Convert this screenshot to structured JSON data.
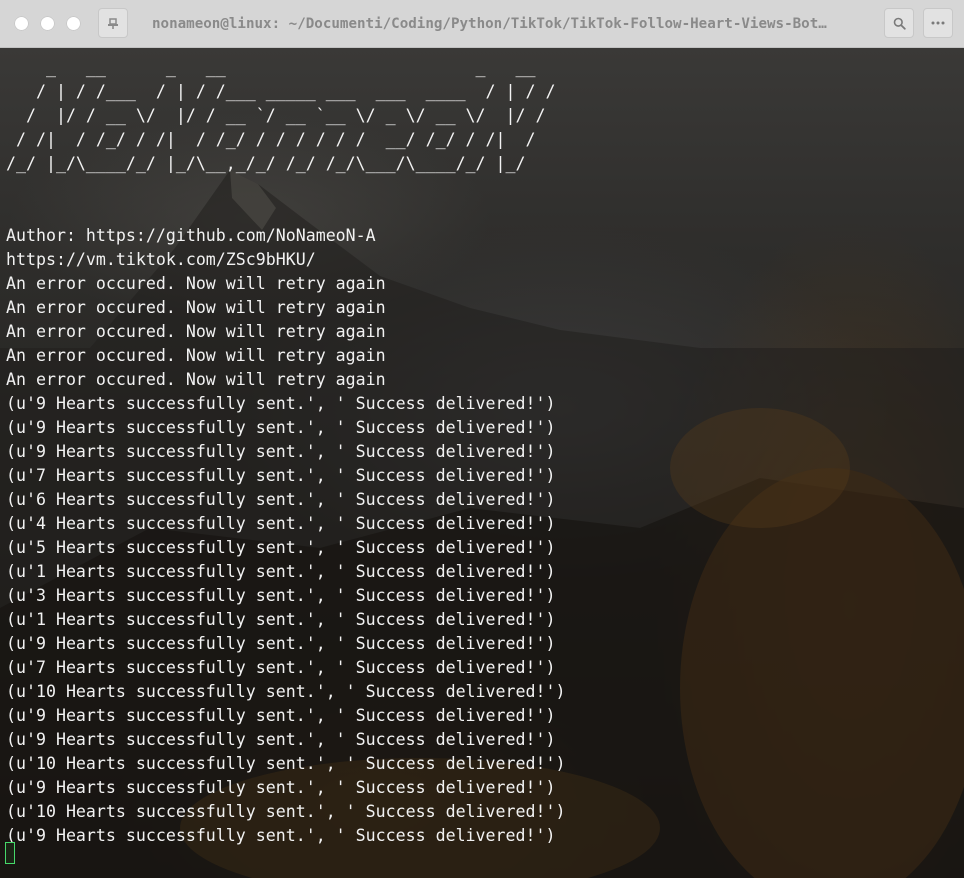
{
  "window": {
    "title": "nonameon@linux: ~/Documenti/Coding/Python/TikTok/TikTok-Follow-Heart-Views-Bot…",
    "buttons": {
      "close": "close-icon",
      "minimize": "minimize-icon",
      "maximize": "maximize-icon",
      "left": "pin-icon",
      "search": "search-icon",
      "menu": "menu-dots-icon"
    }
  },
  "terminal": {
    "banner": [
      "    _   __      _   __                         _   __",
      "   / | / /___  / | / /___ _____ ___  ___  ____  / | / /",
      "  /  |/ / __ \\/  |/ / __ `/ __ `__ \\/ _ \\/ __ \\/  |/ /",
      " / /|  / /_/ / /|  / /_/ / / / / / /  __/ /_/ / /|  /",
      "/_/ |_/\\____/_/ |_/\\__,_/_/ /_/ /_/\\___/\\____/_/ |_/",
      "",
      ""
    ],
    "output": [
      "Author: https://github.com/NoNameoN-A",
      "https://vm.tiktok.com/ZSc9bHKU/",
      "An error occured. Now will retry again",
      "An error occured. Now will retry again",
      "An error occured. Now will retry again",
      "An error occured. Now will retry again",
      "An error occured. Now will retry again",
      "(u'9 Hearts successfully sent.', ' Success delivered!')",
      "(u'9 Hearts successfully sent.', ' Success delivered!')",
      "(u'9 Hearts successfully sent.', ' Success delivered!')",
      "(u'7 Hearts successfully sent.', ' Success delivered!')",
      "(u'6 Hearts successfully sent.', ' Success delivered!')",
      "(u'4 Hearts successfully sent.', ' Success delivered!')",
      "(u'5 Hearts successfully sent.', ' Success delivered!')",
      "(u'1 Hearts successfully sent.', ' Success delivered!')",
      "(u'3 Hearts successfully sent.', ' Success delivered!')",
      "(u'1 Hearts successfully sent.', ' Success delivered!')",
      "(u'9 Hearts successfully sent.', ' Success delivered!')",
      "(u'7 Hearts successfully sent.', ' Success delivered!')",
      "(u'10 Hearts successfully sent.', ' Success delivered!')",
      "(u'9 Hearts successfully sent.', ' Success delivered!')",
      "(u'9 Hearts successfully sent.', ' Success delivered!')",
      "(u'10 Hearts successfully sent.', ' Success delivered!')",
      "(u'9 Hearts successfully sent.', ' Success delivered!')",
      "(u'10 Hearts successfully sent.', ' Success delivered!')",
      "(u'9 Hearts successfully sent.', ' Success delivered!')"
    ]
  },
  "colors": {
    "text": "#f2f2f2",
    "cursor": "#46d96a",
    "titlebar": "#d6d6d6",
    "title_text": "#8a8a8a"
  }
}
